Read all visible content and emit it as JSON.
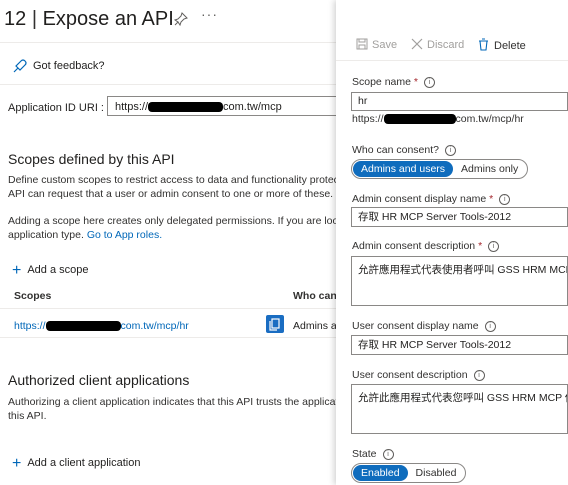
{
  "page": {
    "title_prefix": "12",
    "title": "Expose an API",
    "pin_icon": "pin-icon",
    "more_label": "···"
  },
  "feedback": {
    "label": "Got feedback?"
  },
  "app_id": {
    "label": "Application ID URI :",
    "value_prefix": "https://",
    "value_suffix": "com.tw/mcp"
  },
  "scopes_section": {
    "heading": "Scopes defined by this API",
    "desc_line1": "Define custom scopes to restrict access to data and functionality protect",
    "desc_line2": "API can request that a user or admin consent to one or more of these.",
    "note_line1": "Adding a scope here creates only delegated permissions. If you are look",
    "note_line2_text": "application type.",
    "note_link": "Go to App roles.",
    "add_label": "Add a scope",
    "col_scopes": "Scopes",
    "col_who": "Who can",
    "row_prefix": "https://",
    "row_suffix": "com.tw/mcp/hr",
    "row_who": "Admins a"
  },
  "clients_section": {
    "heading": "Authorized client applications",
    "desc_line1": "Authorizing a client application indicates that this API trusts the applicat",
    "desc_line2": "this API.",
    "add_label": "Add a client application"
  },
  "panel": {
    "save": "Save",
    "discard": "Discard",
    "delete": "Delete",
    "scope_name_label": "Scope name",
    "scope_name_value": "hr",
    "scope_url_prefix": "https://",
    "scope_url_suffix": "com.tw/mcp/hr",
    "who_label": "Who can consent?",
    "who_opt1": "Admins and users",
    "who_opt2": "Admins only",
    "admin_display_label": "Admin consent display name",
    "admin_display_value": "存取 HR MCP Server Tools-2012",
    "admin_desc_label": "Admin consent description",
    "admin_desc_value": "允許應用程式代表使用者呼叫 GSS HRM MCP",
    "user_display_label": "User consent display name",
    "user_display_value": "存取 HR MCP Server Tools-2012",
    "user_desc_label": "User consent description",
    "user_desc_value": "允許此應用程式代表您呼叫 GSS HRM MCP 伺",
    "state_label": "State",
    "state_opt1": "Enabled",
    "state_opt2": "Disabled"
  },
  "colors": {
    "accent": "#0f6cbd",
    "link": "#0067b8",
    "required": "#a4262c"
  }
}
